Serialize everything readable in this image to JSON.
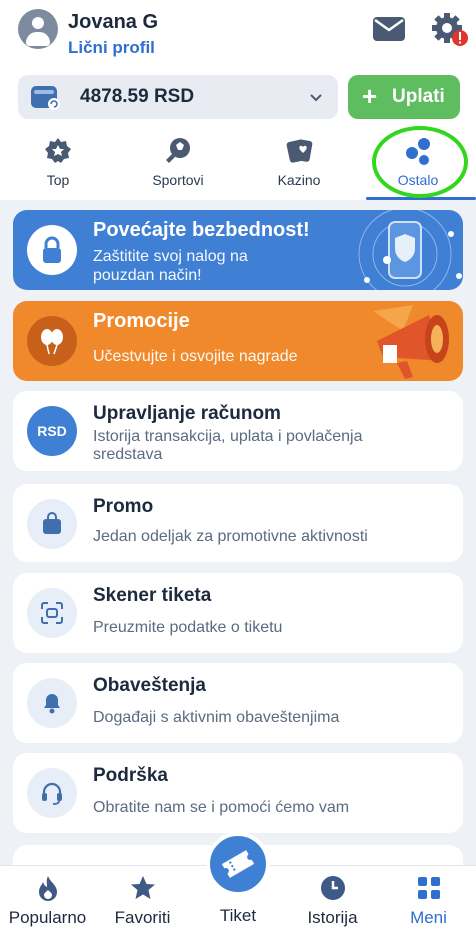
{
  "header": {
    "user_name": "Jovana G",
    "profile_link": "Lični profil",
    "balance": "4878.59 RSD",
    "deposit_label": "Uplati",
    "deposit_icon": "+"
  },
  "category_tabs": [
    {
      "label": "Top",
      "icon": "badge-icon",
      "active": false
    },
    {
      "label": "Sportovi",
      "icon": "sports-icon",
      "active": false
    },
    {
      "label": "Kazino",
      "icon": "cards-icon",
      "active": false
    },
    {
      "label": "Ostalo",
      "icon": "dots-icon",
      "active": true
    }
  ],
  "banners": {
    "security": {
      "title": "Povećajte bezbednost!",
      "subtitle": "Zaštitite svoj nalog na pouzdan način!"
    },
    "promo": {
      "title": "Promocije",
      "subtitle": "Učestvujte i osvojite nagrade"
    }
  },
  "menu": [
    {
      "title": "Upravljanje računom",
      "subtitle": "Istorija transakcija, uplata i povlačenja sredstava",
      "icon_text": "RSD"
    },
    {
      "title": "Promo",
      "subtitle": "Jedan odeljak za promotivne aktivnosti"
    },
    {
      "title": "Skener tiketa",
      "subtitle": "Preuzmite podatke o tiketu"
    },
    {
      "title": "Obaveštenja",
      "subtitle": "Događaji s aktivnim obaveštenjima"
    },
    {
      "title": "Podrška",
      "subtitle": "Obratite nam se i pomoći ćemo vam"
    }
  ],
  "bottom_nav": [
    {
      "label": "Popularno",
      "icon": "flame-icon"
    },
    {
      "label": "Favoriti",
      "icon": "star-icon"
    },
    {
      "label": "Tiket",
      "icon": "ticket-icon"
    },
    {
      "label": "Istorija",
      "icon": "clock-icon"
    },
    {
      "label": "Meni",
      "icon": "grid-icon",
      "active": true
    }
  ],
  "colors": {
    "accent": "#2e6fd0",
    "deposit": "#5ebd5f",
    "security_banner": "#3f7fd4",
    "promo_banner": "#f0892b",
    "highlight_ring": "#33d61e",
    "alert_badge": "#e0352b"
  }
}
